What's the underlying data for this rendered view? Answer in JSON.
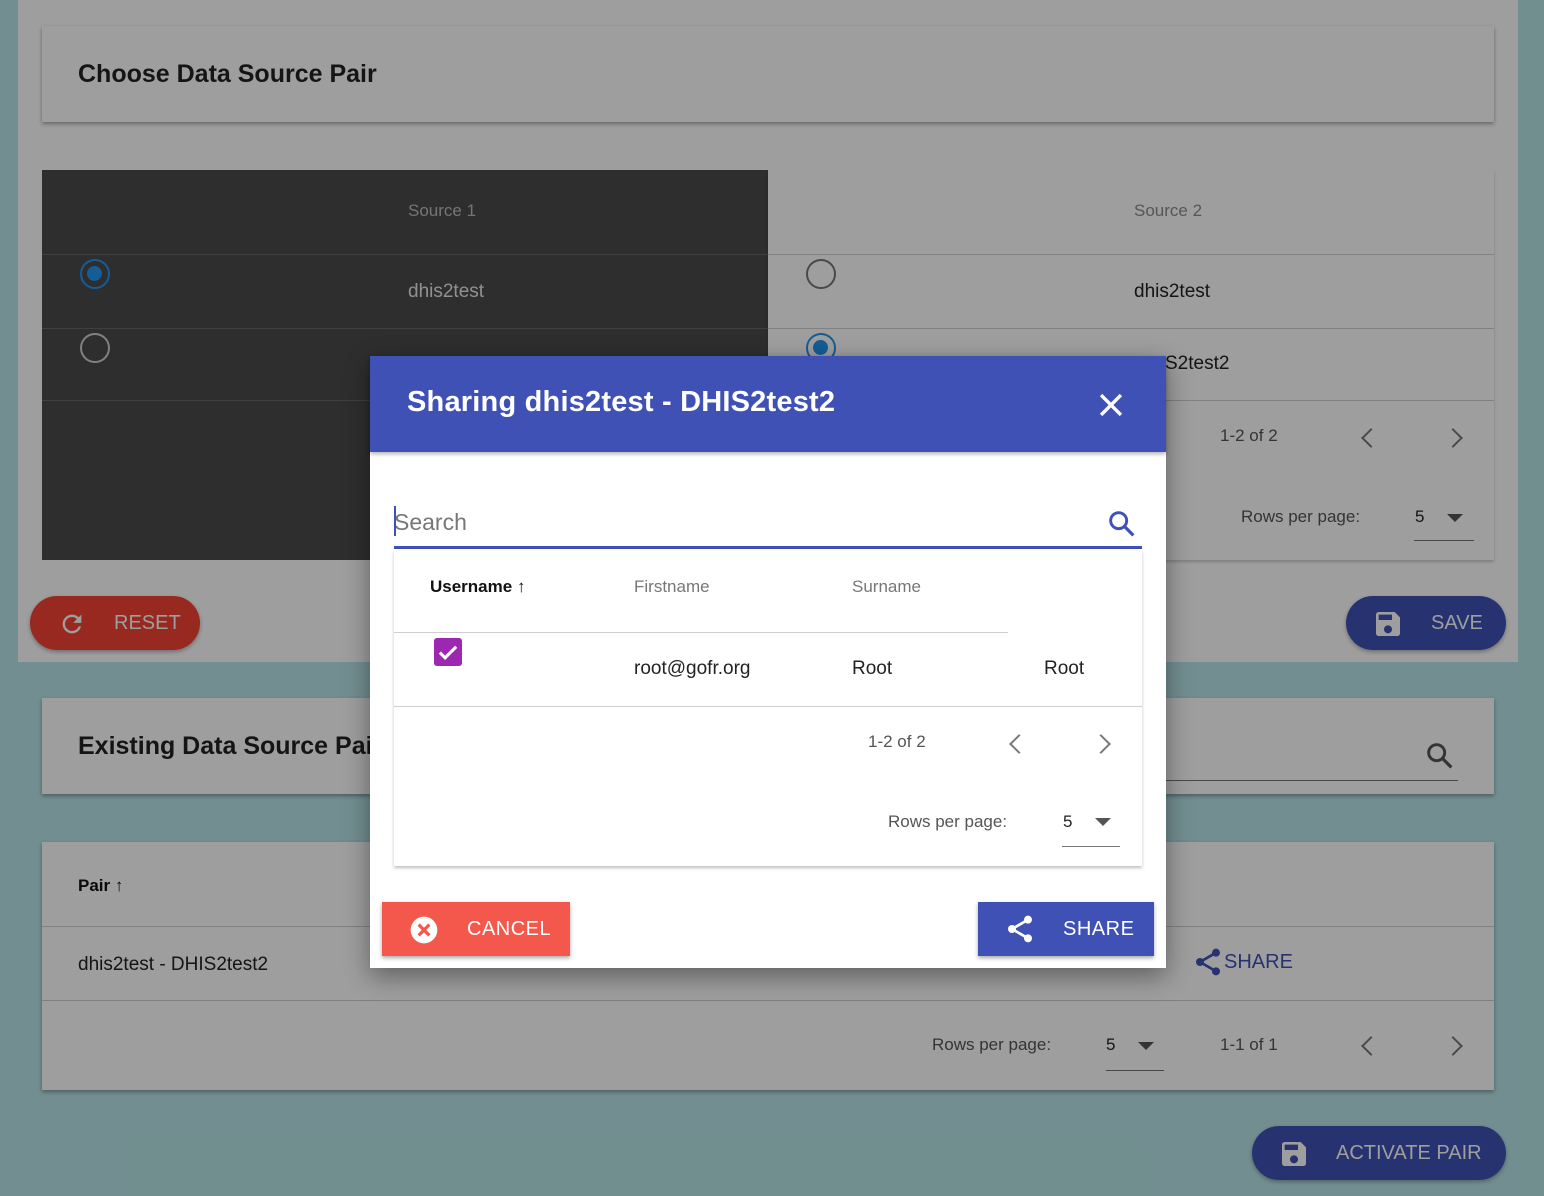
{
  "choose_card": {
    "title": "Choose Data Source Pair"
  },
  "sources": {
    "source1_header": "Source 1",
    "source2_header": "Source 2",
    "source1_rows": [
      "dhis2test",
      ""
    ],
    "source2_rows": [
      "dhis2test",
      "S2test2"
    ],
    "pagination_range": "1-2 of 2",
    "rows_per_page_label": "Rows per page:",
    "rows_per_page_value": "5"
  },
  "actions": {
    "reset_label": "RESET",
    "save_label": "SAVE"
  },
  "existing_card": {
    "title": "Existing Data Source Pai"
  },
  "pairs_table": {
    "pair_header": "Pair",
    "row_pair": "dhis2test - DHIS2test2",
    "share_label": "SHARE",
    "rows_per_page_label": "Rows per page:",
    "rows_per_page_value": "5",
    "pagination_range": "1-1 of 1"
  },
  "activate_label": "ACTIVATE PAIR",
  "dialog": {
    "title": "Sharing dhis2test - DHIS2test2",
    "search_placeholder": "Search",
    "columns": [
      "Username",
      "Firstname",
      "Surname"
    ],
    "rows": [
      {
        "username": "root@gofr.org",
        "firstname": "Root",
        "surname": "Root",
        "checked": true
      }
    ],
    "pagination_range": "1-2 of 2",
    "rows_per_page_label": "Rows per page:",
    "rows_per_page_value": "5",
    "cancel_label": "CANCEL",
    "share_label": "SHARE"
  },
  "colors": {
    "primary": "#3f51b5",
    "danger": "#f44336",
    "checkbox": "#9c27b0",
    "radio": "#2196f3"
  }
}
